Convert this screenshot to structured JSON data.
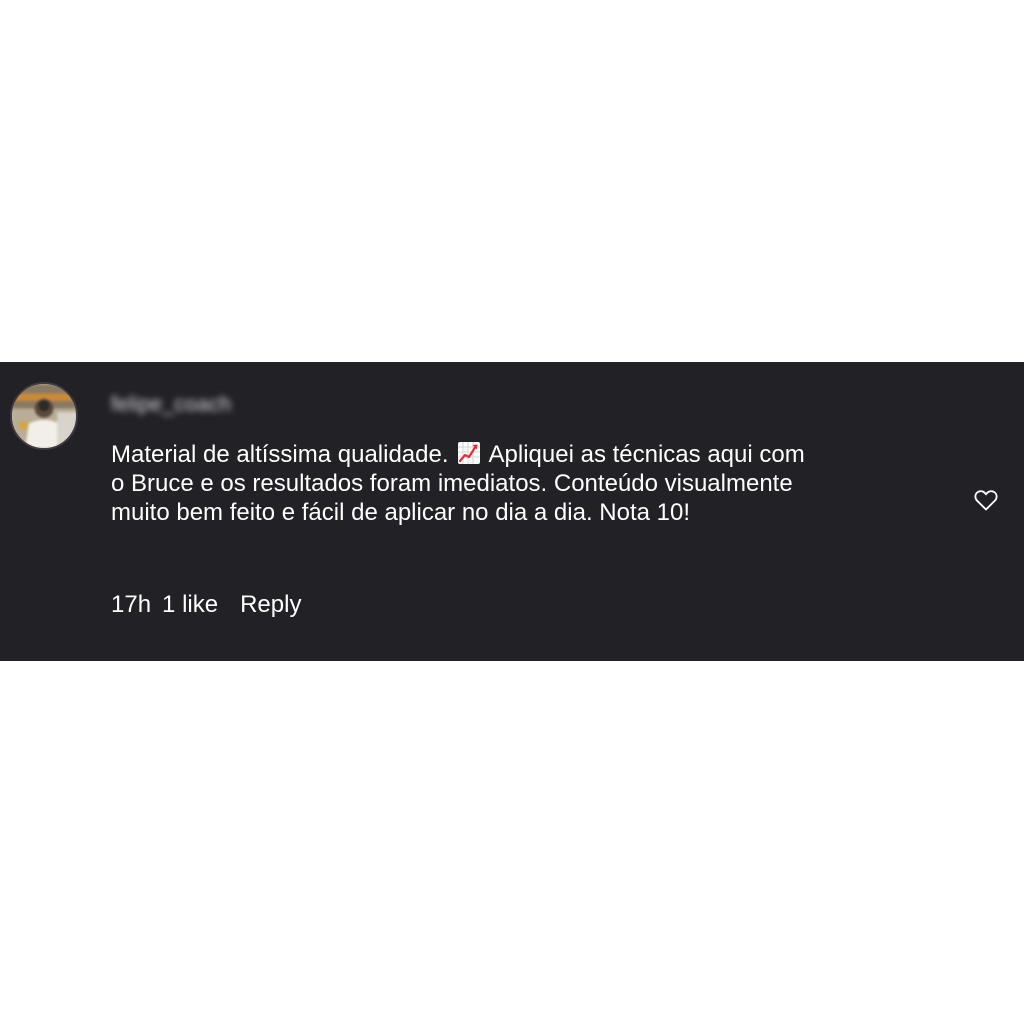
{
  "comment": {
    "username": "felipe_coach",
    "text_lines": [
      {
        "before_emoji": "Material de altíssima qualidade.",
        "emoji": "chart-increasing-emoji",
        "after_emoji": "Apliquei as técnicas aqui com"
      },
      "o Bruce e os resultados foram imediatos. Conteúdo visualmente",
      "muito bem feito e fácil de aplicar no dia a dia. Nota 10!"
    ],
    "time": "17h",
    "likes": "1 like",
    "reply_label": "Reply",
    "like_icon": "heart-outline-icon"
  },
  "colors": {
    "card_background": "#222226",
    "page_background": "#ffffff",
    "text": "#ffffff"
  }
}
